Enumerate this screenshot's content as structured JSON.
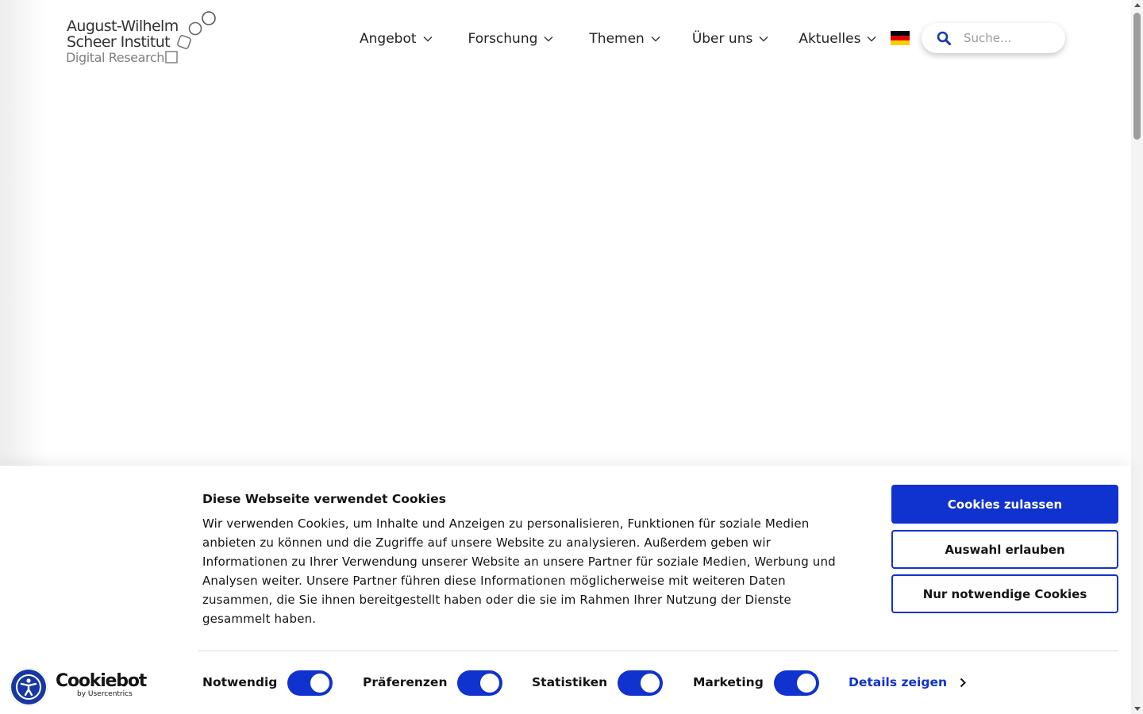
{
  "logo": {
    "line1": "August-Wilhelm",
    "line2": "Scheer Institut",
    "line3": "Digital Research"
  },
  "nav": [
    {
      "label": "Angebot"
    },
    {
      "label": "Forschung"
    },
    {
      "label": "Themen"
    },
    {
      "label": "Über uns"
    },
    {
      "label": "Aktuelles"
    }
  ],
  "language": {
    "icon": "flag-de-icon",
    "colors": [
      "#000000",
      "#dd0000",
      "#ffce00"
    ]
  },
  "search": {
    "placeholder": "Suche...",
    "value": "",
    "icon": "search-icon"
  },
  "cookie_banner": {
    "title": "Diese Webseite verwendet Cookies",
    "text": "Wir verwenden Cookies, um Inhalte und Anzeigen zu personalisieren, Funktionen für soziale Medien anbieten zu können und die Zugriffe auf unsere Website zu analysieren. Außerdem geben wir Informationen zu Ihrer Verwendung unserer Website an unsere Partner für soziale Medien, Werbung und Analysen weiter. Unsere Partner führen diese Informationen möglicherweise mit weiteren Daten zusammen, die Sie ihnen bereitgestellt haben oder die sie im Rahmen Ihrer Nutzung der Dienste gesammelt haben.",
    "buttons": {
      "allow_all": "Cookies zulassen",
      "allow_selection": "Auswahl erlauben",
      "necessary_only": "Nur notwendige Cookies"
    },
    "consents": [
      {
        "label": "Notwendig",
        "checked": true
      },
      {
        "label": "Präferenzen",
        "checked": true
      },
      {
        "label": "Statistiken",
        "checked": true
      },
      {
        "label": "Marketing",
        "checked": true
      }
    ],
    "details_label": "Details zeigen",
    "brand": {
      "name": "Cookiebot",
      "by": "by Usercentrics"
    }
  },
  "colors": {
    "accent": "#1032cf",
    "accessibility": "#1737a3"
  }
}
